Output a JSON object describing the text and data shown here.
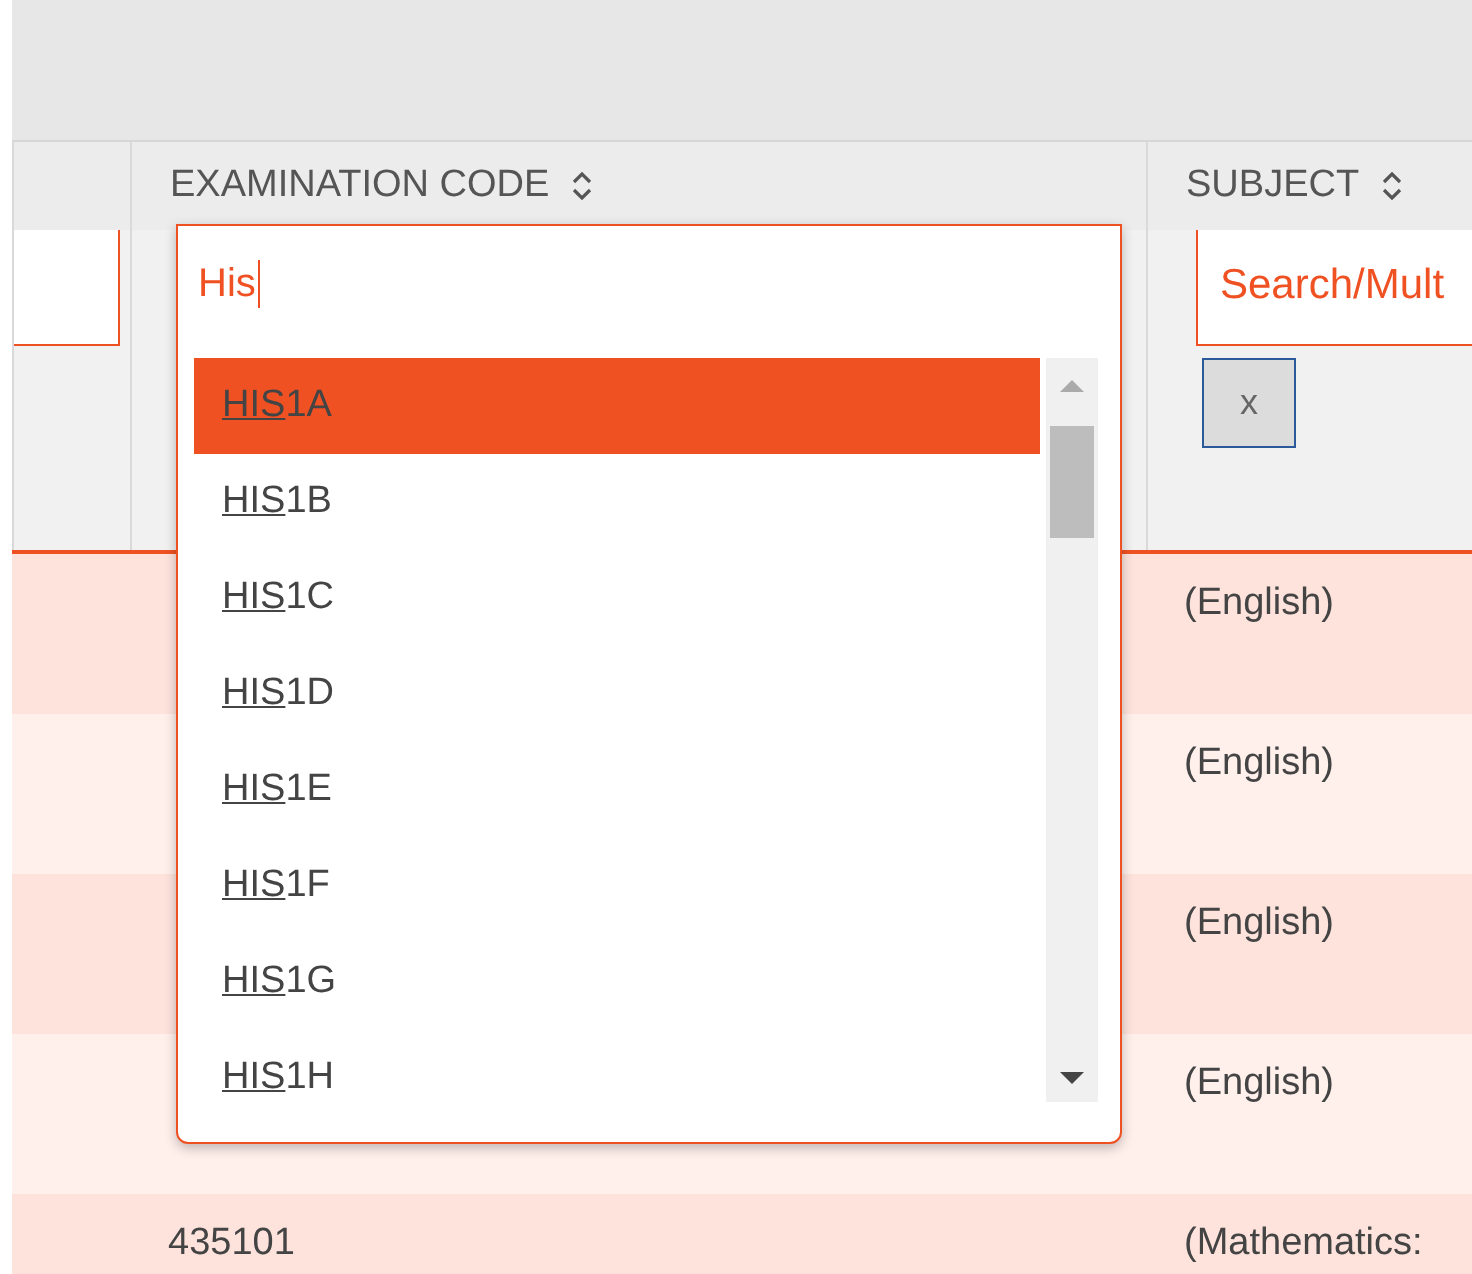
{
  "columns": [
    {
      "sortable": false
    },
    {
      "label": "EXAMINATION CODE",
      "sortable": true
    },
    {
      "label": "SUBJECT",
      "sortable": true
    }
  ],
  "filters": {
    "subject": {
      "placeholder": "Search/Mult"
    },
    "clear_button": "x"
  },
  "rows": [
    {
      "subject": "(English)"
    },
    {
      "subject": "(English)"
    },
    {
      "subject": "(English)"
    },
    {
      "subject": "(English)"
    },
    {
      "code": "435101",
      "subject": "(Mathematics:"
    }
  ],
  "dropdown": {
    "value": "His",
    "options": [
      {
        "match": "HIS",
        "rest": "1A",
        "selected": true
      },
      {
        "match": "HIS",
        "rest": "1B",
        "selected": false
      },
      {
        "match": "HIS",
        "rest": "1C",
        "selected": false
      },
      {
        "match": "HIS",
        "rest": "1D",
        "selected": false
      },
      {
        "match": "HIS",
        "rest": "1E",
        "selected": false
      },
      {
        "match": "HIS",
        "rest": "1F",
        "selected": false
      },
      {
        "match": "HIS",
        "rest": "1G",
        "selected": false
      },
      {
        "match": "HIS",
        "rest": "1H",
        "selected": false
      }
    ]
  }
}
